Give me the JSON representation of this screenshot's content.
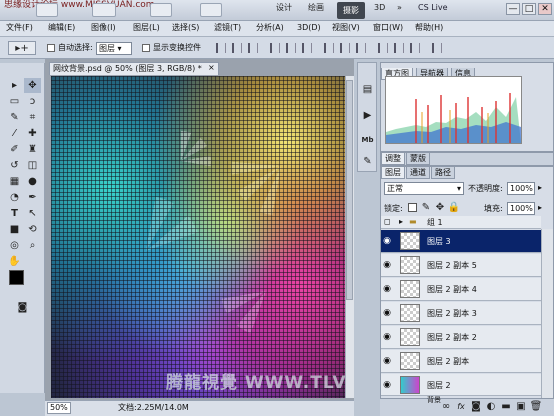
{
  "watermark": "思缘设计论坛 www.MISSVUAN.com",
  "appbar": {
    "buttons": [
      "设计",
      "绘画",
      "摄影",
      "3D"
    ],
    "active": "摄影",
    "more": "»",
    "cslive": "CS Live",
    "window_buttons": [
      "—",
      "□",
      "✕"
    ]
  },
  "menu": [
    "文件(F)",
    "编辑(E)",
    "图像(I)",
    "图层(L)",
    "选择(S)",
    "滤镜(T)",
    "分析(A)",
    "3D(D)",
    "视图(V)",
    "窗口(W)",
    "帮助(H)"
  ],
  "options": {
    "autoselect_label": "自动选择:",
    "autoselect_value": "图层",
    "show_transform": "显示变换控件"
  },
  "document": {
    "tab_title": "网纹背景.psd @ 50% (图层 3, RGB/8) *",
    "close": "×",
    "zoom": "50%",
    "info": "文档:2.25M/14.0M",
    "canvas_watermark": "腾龍視覺 WWW.TLVI.NET"
  },
  "histogram_panel": {
    "tabs": [
      "直方图",
      "导航器",
      "信息"
    ],
    "active": "直方图"
  },
  "adjust_tabs": [
    "调整",
    "蒙版"
  ],
  "layers_panel": {
    "tabs": [
      "图层",
      "通道",
      "路径"
    ],
    "active": "图层",
    "blend_mode": "正常",
    "opacity_label": "不透明度:",
    "opacity": "100%",
    "lock_label": "锁定:",
    "fill_label": "填充:",
    "fill": "100%",
    "group_name": "组 1",
    "layers": [
      {
        "name": "图层 3",
        "selected": true
      },
      {
        "name": "图层 2 副本 5",
        "selected": false
      },
      {
        "name": "图层 2 副本 4",
        "selected": false
      },
      {
        "name": "图层 2 副本 3",
        "selected": false
      },
      {
        "name": "图层 2 副本 2",
        "selected": false
      },
      {
        "name": "图层 2 副本",
        "selected": false
      },
      {
        "name": "图层 2",
        "selected": false
      },
      {
        "name": "背景",
        "selected": false
      }
    ]
  },
  "colors": {
    "selected_layer": "#0a246a",
    "active_workspace": "#40464f"
  }
}
